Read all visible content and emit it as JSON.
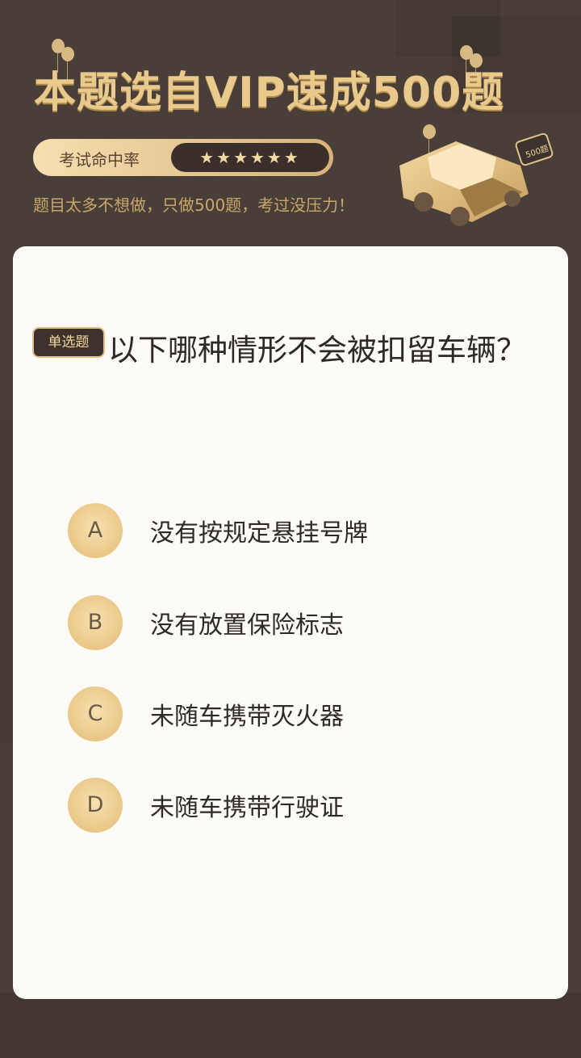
{
  "header": {
    "headline": "本题选自VIP速成500题",
    "rate_label": "考试命中率",
    "stars": "★★★★★★",
    "subtitle": "题目太多不想做，只做500题，考过没压力！",
    "badge_text": "500题"
  },
  "question": {
    "type_tag": "单选题",
    "text": "以下哪种情形不会被扣留车辆？",
    "options": [
      {
        "letter": "A",
        "text": "没有按规定悬挂号牌"
      },
      {
        "letter": "B",
        "text": "没有放置保险标志"
      },
      {
        "letter": "C",
        "text": "未随车携带灭火器"
      },
      {
        "letter": "D",
        "text": "未随车携带行驶证"
      }
    ]
  },
  "colors": {
    "background": "#4a3e38",
    "gold": "#e9c98c",
    "card": "#fdfbf6",
    "option_circle": "#efcc8f"
  },
  "icons": [
    "star-icon",
    "car-icon",
    "balloon-icon"
  ]
}
